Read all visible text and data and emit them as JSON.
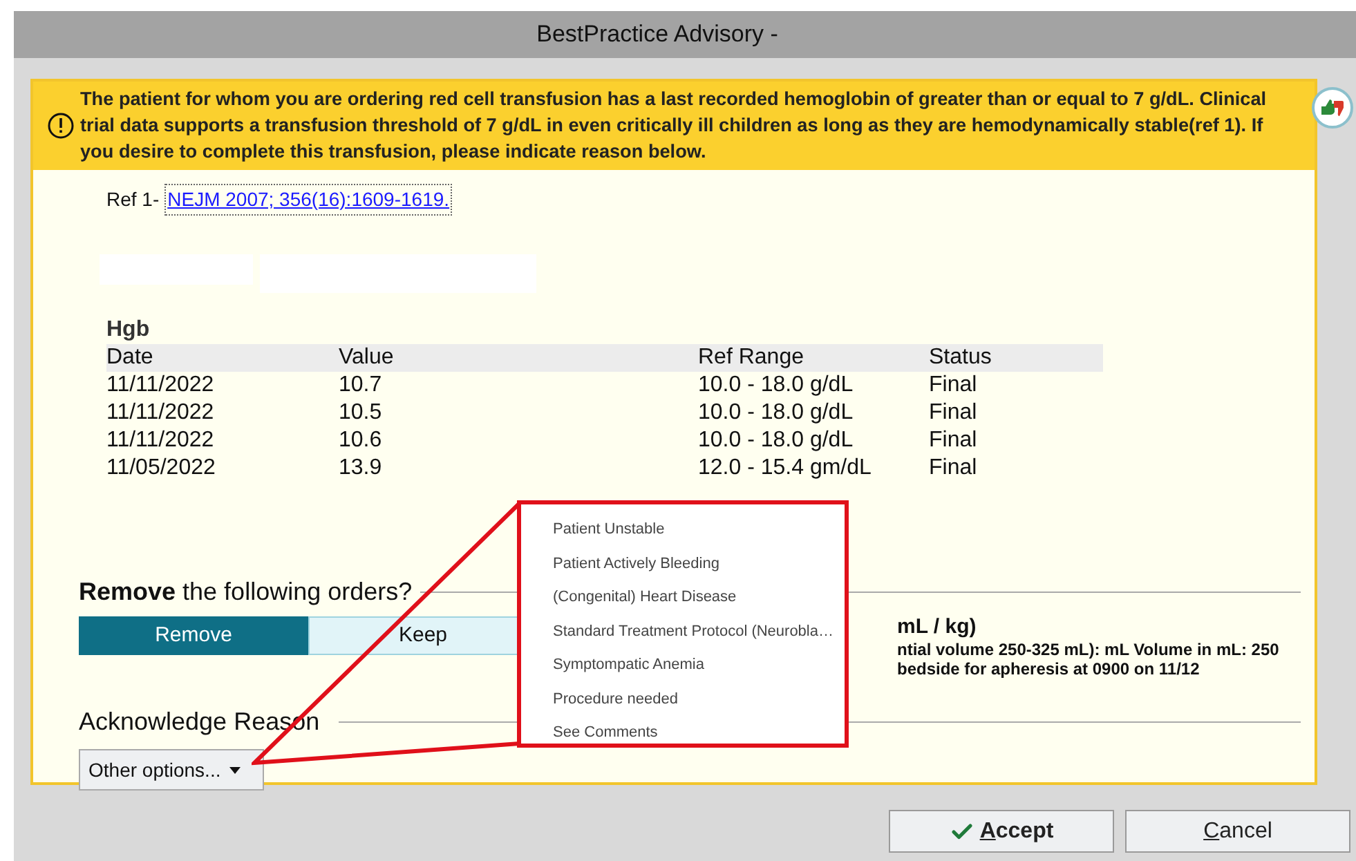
{
  "window": {
    "title": "BestPractice Advisory -"
  },
  "alert": {
    "message": "The patient for whom you are ordering red cell transfusion has a last recorded hemoglobin of greater than or equal to 7 g/dL. Clinical trial data supports a transfusion threshold of 7 g/dL in even critically ill children as long as they are hemodynamically stable(ref 1). If you desire to complete this transfusion, please indicate reason below.",
    "reference_label": "Ref 1-",
    "reference_link": "NEJM 2007; 356(16):1609-1619."
  },
  "lab_results": {
    "title": "Hgb",
    "columns": [
      "Date",
      "Value",
      "Ref Range",
      "Status"
    ],
    "rows": [
      [
        "11/11/2022",
        "10.7",
        "10.0 - 18.0 g/dL",
        "Final"
      ],
      [
        "11/11/2022",
        "10.5",
        "10.0 - 18.0 g/dL",
        "Final"
      ],
      [
        "11/11/2022",
        "10.6",
        "10.0 - 18.0 g/dL",
        "Final"
      ],
      [
        "11/05/2022",
        "13.9",
        "12.0 - 15.4 gm/dL",
        "Final"
      ]
    ]
  },
  "remove_orders": {
    "heading": "**Remove** the following orders?",
    "options": [
      {
        "label": "Remove",
        "selected": true
      },
      {
        "label": "Keep",
        "selected": false
      }
    ],
    "order_lines": [
      "mL / kg)",
      "ntial volume 250-325 mL): mL Volume in mL: 250",
      "bedside for apheresis at 0900 on 11/12"
    ]
  },
  "acknowledge": {
    "heading": "Acknowledge Reason",
    "dropdown": {
      "value": "Other options...",
      "expanded": true,
      "options": [
        "Patient Unstable",
        "Patient Actively Bleeding",
        "(Congenital) Heart Disease",
        "Standard Treatment Protocol (Neurobla…",
        "Symptompatic Anemia",
        "Procedure needed",
        "See Comments"
      ]
    }
  },
  "buttons": [
    {
      "label": "Accept",
      "kind": "primary"
    },
    {
      "label": "Cancel",
      "kind": "secondary"
    }
  ]
}
